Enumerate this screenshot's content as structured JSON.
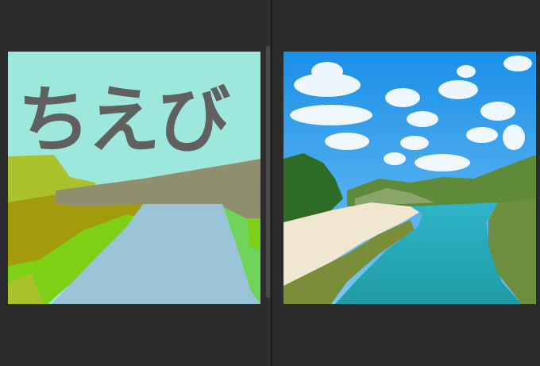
{
  "left_canvas": {
    "sketch_text": "ちえび",
    "colors": {
      "sky": "#9de7dc",
      "text": "#606060",
      "river": "#9bc3d8",
      "mountain": "#8f8f6e",
      "olive": "#a39a0c",
      "lime": "#a9c22c",
      "green": "#7dd015",
      "light_green": "#6fd35a"
    }
  },
  "right_canvas": {
    "description_icon": "landscape-photo",
    "colors": {
      "sky_top": "#1a8fe8",
      "sky_bottom": "#7cc6f3",
      "sand": "#f1e6cf",
      "water": "#23a8b3",
      "hill": "#5f8a3a"
    }
  }
}
